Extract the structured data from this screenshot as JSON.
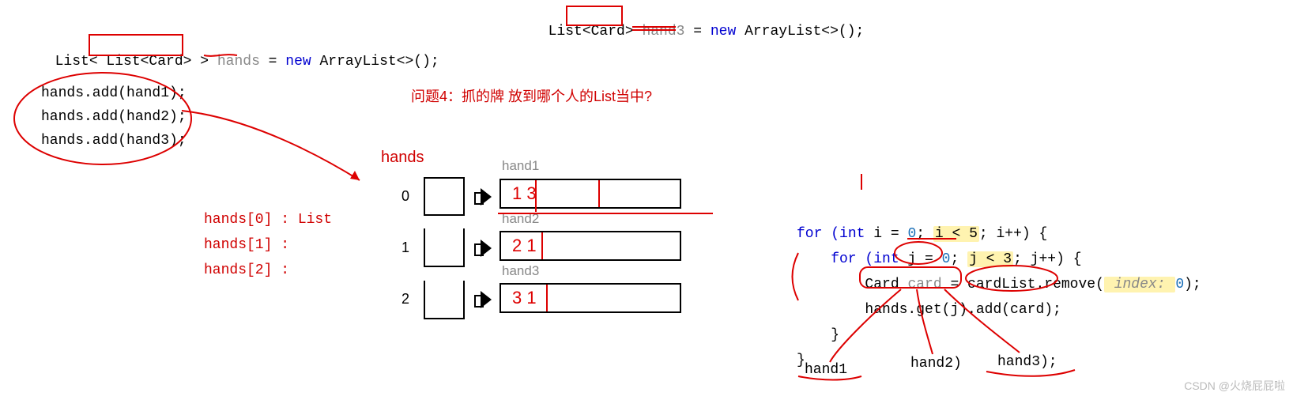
{
  "code_top_right": {
    "line": "List<Card> hand3 = new ArrayList<>();",
    "type_prefix": "List",
    "generic": "<Card>",
    "var": "hand3",
    "assign": " = ",
    "new_kw": "new",
    "ctor": " ArrayList<>();"
  },
  "code_top_left": {
    "line": "List< List<Card> > hands = new ArrayList<>();",
    "pre": "List< ",
    "inner": "List<Card>",
    "post": " > ",
    "var": "hands",
    "assign": " = ",
    "new_kw": "new",
    "ctor": " ArrayList<>();"
  },
  "adds": {
    "l1": "hands.add(hand1);",
    "l2": "hands.add(hand2);",
    "l3": "hands.add(hand3);"
  },
  "question": "问题4：抓的牌 放到哪个人的List当中?",
  "left_labels": {
    "a": "hands[0] :  List",
    "b": "hands[1] :",
    "c": "hands[2] :"
  },
  "diagram": {
    "title": "hands",
    "idx0": "0",
    "idx1": "1",
    "idx2": "2",
    "h1": "hand1",
    "h2": "hand2",
    "h3": "hand3",
    "row0_scribble": "1    3",
    "row1_scribble": "2    1",
    "row2_scribble": "3    1"
  },
  "loop": {
    "l1_pre": "for (",
    "l1_int": "int",
    "l1_mid": " i = ",
    "l1_zero": "0",
    "l1_cond_pre": "; ",
    "l1_cond": "i < 5",
    "l1_post": "; i++) {",
    "l2_pre": "    for (",
    "l2_int": "int",
    "l2_mid": " j = ",
    "l2_zero": "0",
    "l2_cond_pre": "; ",
    "l2_cond": "j < 3",
    "l2_post": "; j++) {",
    "l3_pre": "        Card ",
    "l3_var": "card",
    "l3_mid": " = cardList.remove(",
    "l3_hint": " index: ",
    "l3_arg": "0",
    "l3_post": ");",
    "l4": "        hands.get(j).add(card);",
    "l5": "    }",
    "l6": "}"
  },
  "hand_labels": {
    "h1": "hand1",
    "h2": "hand2)",
    "h3": "hand3);"
  },
  "watermark": "CSDN @火烧屁屁啦"
}
